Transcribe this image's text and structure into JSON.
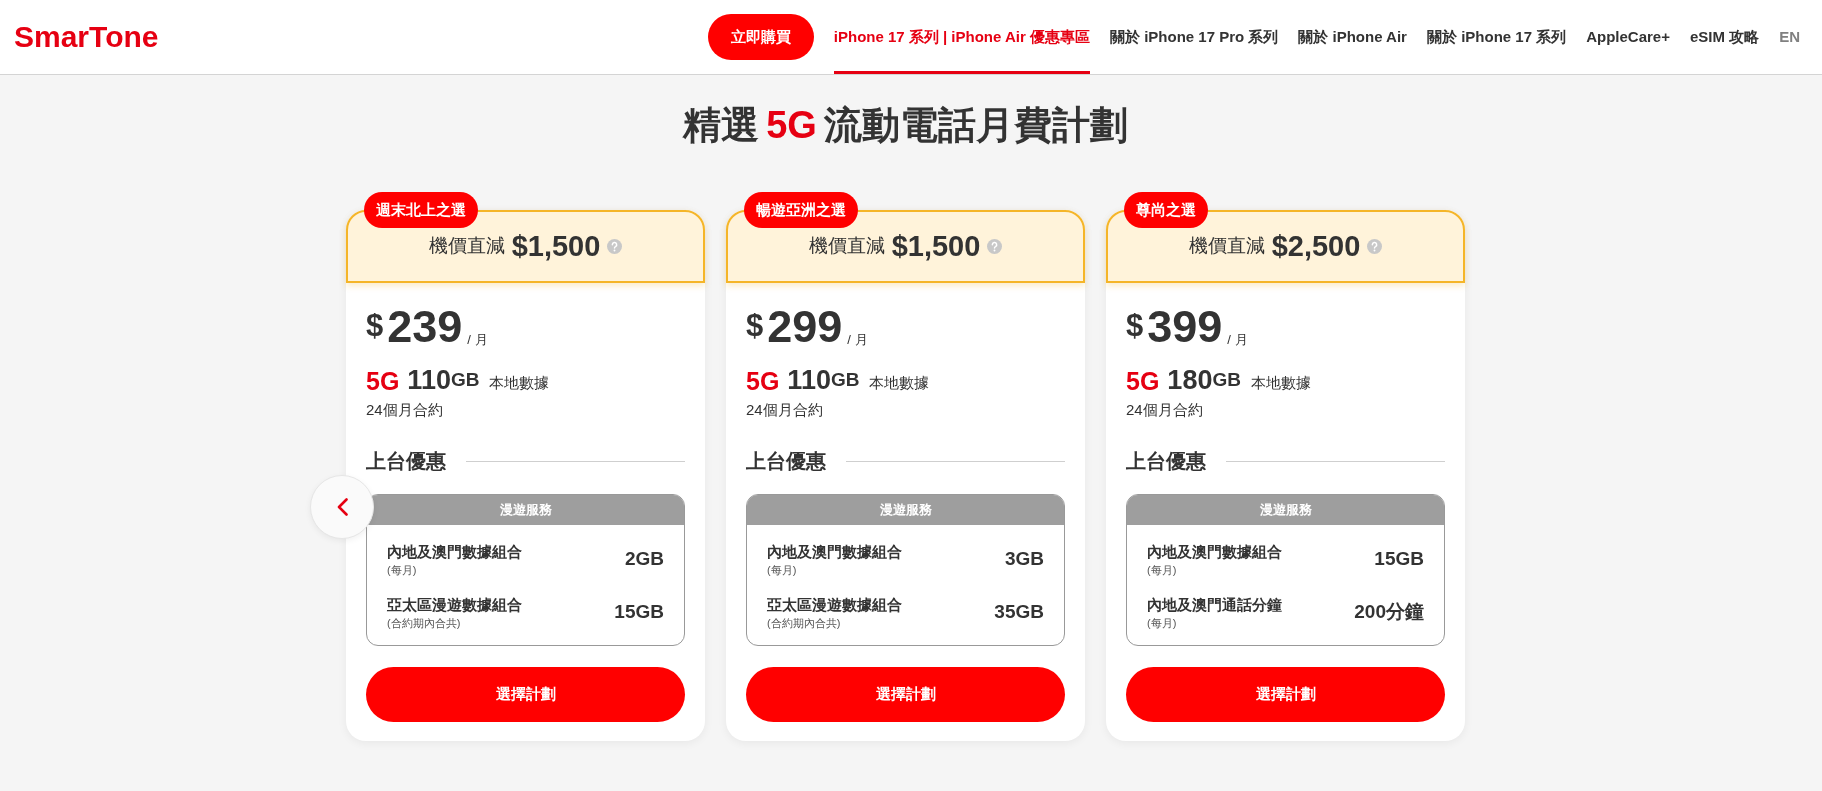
{
  "header": {
    "logo": "SmarTone",
    "buy_button": "立即購買",
    "nav": [
      {
        "label": "iPhone 17 系列 | iPhone Air 優惠專區",
        "selected": true
      },
      {
        "label": "關於 iPhone 17 Pro 系列",
        "selected": false
      },
      {
        "label": "關於 iPhone Air",
        "selected": false
      },
      {
        "label": "關於 iPhone 17 系列",
        "selected": false
      },
      {
        "label": "AppleCare+",
        "selected": false
      },
      {
        "label": "eSIM 攻略",
        "selected": false
      }
    ],
    "language": "EN"
  },
  "heading": {
    "before": "精選",
    "network": "5G",
    "after": "流動電話月費計劃"
  },
  "plans": [
    {
      "tag": "週末北上之選",
      "discount_label": "機價直減",
      "discount_amount": "$1,500",
      "currency": "$",
      "price": "239",
      "period": "/ 月",
      "network": "5G",
      "data_amount": "110",
      "data_unit": "GB",
      "data_label": "本地數據",
      "contract": "24個月合約",
      "offers_title": "上台優惠",
      "perk_panel_title": "漫遊服務",
      "perks": [
        {
          "name": "內地及澳門數據組合",
          "note": "(每月)",
          "value": "2GB"
        },
        {
          "name": "亞太區漫遊數據組合",
          "note": "(合約期內合共)",
          "value": "15GB"
        }
      ],
      "button": "選擇計劃"
    },
    {
      "tag": "暢遊亞洲之選",
      "discount_label": "機價直減",
      "discount_amount": "$1,500",
      "currency": "$",
      "price": "299",
      "period": "/ 月",
      "network": "5G",
      "data_amount": "110",
      "data_unit": "GB",
      "data_label": "本地數據",
      "contract": "24個月合約",
      "offers_title": "上台優惠",
      "perk_panel_title": "漫遊服務",
      "perks": [
        {
          "name": "內地及澳門數據組合",
          "note": "(每月)",
          "value": "3GB"
        },
        {
          "name": "亞太區漫遊數據組合",
          "note": "(合約期內合共)",
          "value": "35GB"
        }
      ],
      "button": "選擇計劃"
    },
    {
      "tag": "尊尚之選",
      "discount_label": "機價直減",
      "discount_amount": "$2,500",
      "currency": "$",
      "price": "399",
      "period": "/ 月",
      "network": "5G",
      "data_amount": "180",
      "data_unit": "GB",
      "data_label": "本地數據",
      "contract": "24個月合約",
      "offers_title": "上台優惠",
      "perk_panel_title": "漫遊服務",
      "perks": [
        {
          "name": "內地及澳門數據組合",
          "note": "(每月)",
          "value": "15GB"
        },
        {
          "name": "內地及澳門通話分鐘",
          "note": "(每月)",
          "value": "200分鐘"
        }
      ],
      "button": "選擇計劃"
    }
  ]
}
